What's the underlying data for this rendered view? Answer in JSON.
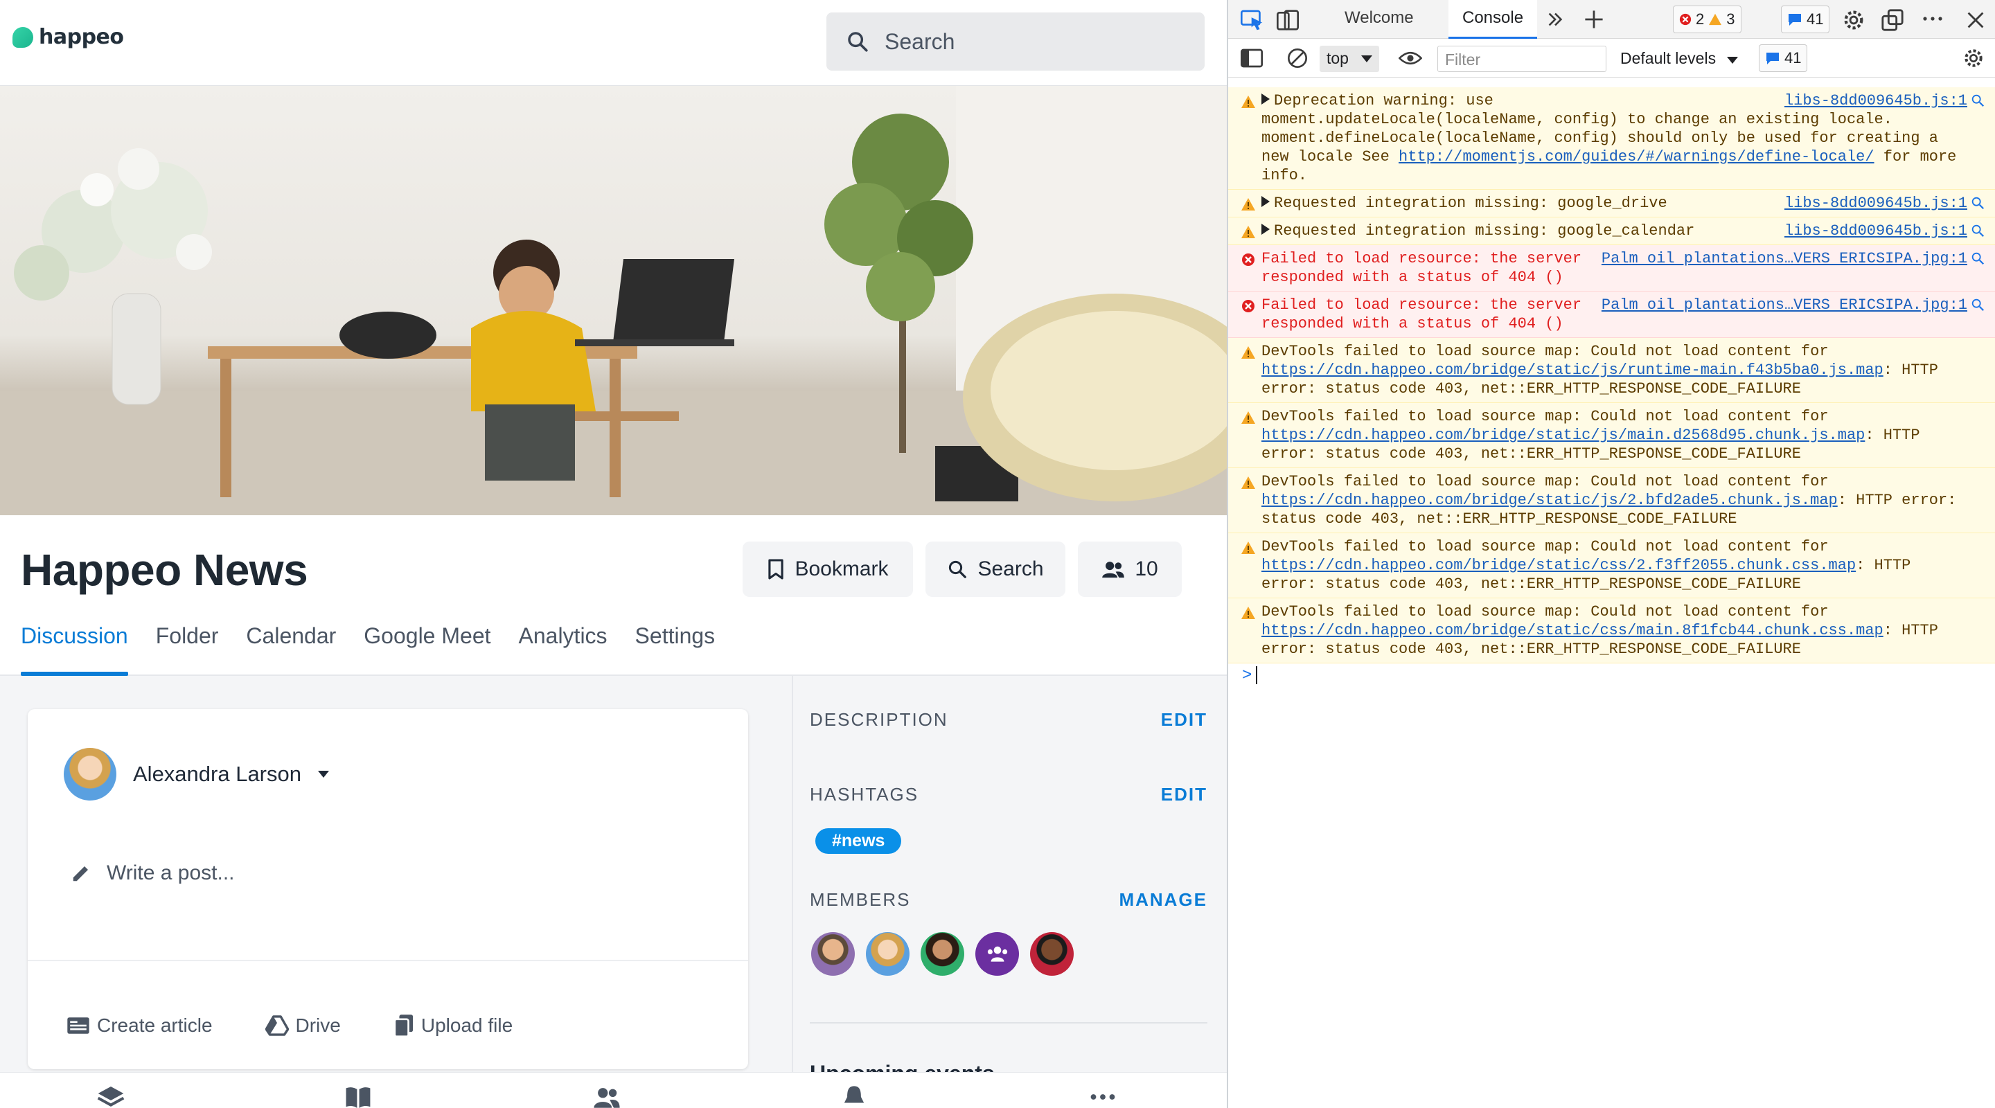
{
  "app": {
    "logo_text": "happeo",
    "search_placeholder": "Search",
    "page_title": "Happeo News",
    "actions": {
      "bookmark": "Bookmark",
      "search": "Search",
      "members_count": "10"
    },
    "tabs": [
      "Discussion",
      "Folder",
      "Calendar",
      "Google Meet",
      "Analytics",
      "Settings"
    ],
    "active_tab": "Discussion",
    "composer": {
      "user_name": "Alexandra Larson",
      "write_placeholder": "Write a post...",
      "actions": [
        "Create article",
        "Drive",
        "Upload file"
      ]
    },
    "sidebar": {
      "description_label": "DESCRIPTION",
      "description_action": "EDIT",
      "hashtags_label": "HASHTAGS",
      "hashtags_action": "EDIT",
      "hashtag": "#news",
      "members_label": "MEMBERS",
      "members_action": "MANAGE",
      "upcoming_label": "Upcoming events"
    },
    "colors": {
      "accent": "#0a7cd6",
      "hashtag": "#0a90e8",
      "brand": "#1bb58e"
    }
  },
  "devtools": {
    "tabs": {
      "welcome": "Welcome",
      "console": "Console"
    },
    "badges": {
      "errors": "2",
      "warnings": "3",
      "messages": "41"
    },
    "toolbar": {
      "context": "top",
      "filter_placeholder": "Filter",
      "levels": "Default levels",
      "messages": "41"
    },
    "messages": [
      {
        "level": "warning",
        "expandable": true,
        "text": "Deprecation warning: use moment.updateLocale(localeName, config) to change an existing locale. moment.defineLocale(localeName, config) should only be used for creating a new locale See ",
        "link": "http://momentjs.com/guides/#/warnings/define-locale/",
        "after": " for more info.",
        "source": "libs-8dd009645b.js:1"
      },
      {
        "level": "warning",
        "expandable": true,
        "text": "Requested integration missing: google_drive",
        "link": "",
        "after": "",
        "source": "libs-8dd009645b.js:1"
      },
      {
        "level": "warning",
        "expandable": true,
        "text": "Requested integration missing: google_calendar",
        "link": "",
        "after": "",
        "source": "libs-8dd009645b.js:1"
      },
      {
        "level": "error",
        "expandable": false,
        "text": "Failed to load resource: the server responded with a status of 404 ()",
        "link": "",
        "after": "",
        "source": "Palm oil plantations…VERS ERICSIPA.jpg:1"
      },
      {
        "level": "error",
        "expandable": false,
        "text": "Failed to load resource: the server responded with a status of 404 ()",
        "link": "",
        "after": "",
        "source": "Palm oil plantations…VERS ERICSIPA.jpg:1"
      },
      {
        "level": "warning",
        "expandable": false,
        "text": "DevTools failed to load source map: Could not load content for ",
        "link": "https://cdn.happeo.com/bridge/static/js/runtime-main.f43b5ba0.js.map",
        "after": ": HTTP error: status code 403, net::ERR_HTTP_RESPONSE_CODE_FAILURE",
        "source": ""
      },
      {
        "level": "warning",
        "expandable": false,
        "text": "DevTools failed to load source map: Could not load content for ",
        "link": "https://cdn.happeo.com/bridge/static/js/main.d2568d95.chunk.js.map",
        "after": ": HTTP error: status code 403, net::ERR_HTTP_RESPONSE_CODE_FAILURE",
        "source": ""
      },
      {
        "level": "warning",
        "expandable": false,
        "text": "DevTools failed to load source map: Could not load content for ",
        "link": "https://cdn.happeo.com/bridge/static/js/2.bfd2ade5.chunk.js.map",
        "after": ": HTTP error: status code 403, net::ERR_HTTP_RESPONSE_CODE_FAILURE",
        "source": ""
      },
      {
        "level": "warning",
        "expandable": false,
        "text": "DevTools failed to load source map: Could not load content for ",
        "link": "https://cdn.happeo.com/bridge/static/css/2.f3ff2055.chunk.css.map",
        "after": ": HTTP error: status code 403, net::ERR_HTTP_RESPONSE_CODE_FAILURE",
        "source": ""
      },
      {
        "level": "warning",
        "expandable": false,
        "text": "DevTools failed to load source map: Could not load content for ",
        "link": "https://cdn.happeo.com/bridge/static/css/main.8f1fcb44.chunk.css.map",
        "after": ": HTTP error: status code 403, net::ERR_HTTP_RESPONSE_CODE_FAILURE",
        "source": ""
      }
    ]
  }
}
